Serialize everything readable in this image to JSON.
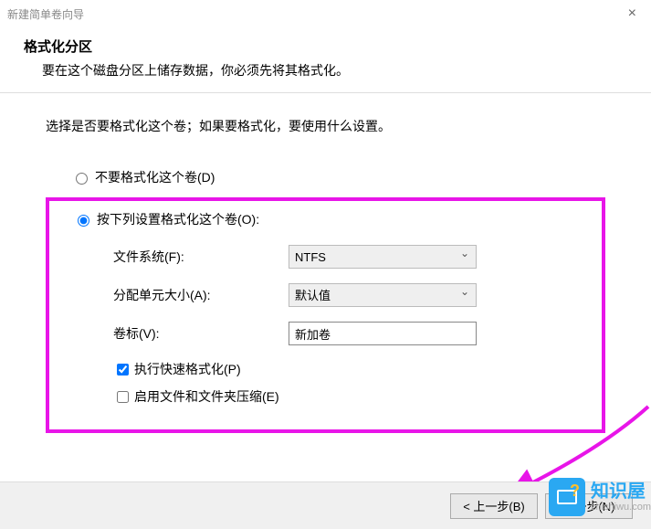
{
  "titlebar": {
    "title": "新建简单卷向导"
  },
  "header": {
    "title": "格式化分区",
    "subtitle": "要在这个磁盘分区上储存数据，你必须先将其格式化。"
  },
  "instruction": "选择是否要格式化这个卷；如果要格式化，要使用什么设置。",
  "radios": {
    "noformat": "不要格式化这个卷(D)",
    "doformat": "按下列设置格式化这个卷(O):"
  },
  "form": {
    "fs_label": "文件系统(F):",
    "fs_value": "NTFS",
    "alloc_label": "分配单元大小(A):",
    "alloc_value": "默认值",
    "volume_label": "卷标(V):",
    "volume_value": "新加卷"
  },
  "checkboxes": {
    "quick": "执行快速格式化(P)",
    "compress": "启用文件和文件夹压缩(E)"
  },
  "buttons": {
    "back": "< 上一步(B)",
    "next": "下一步(N)"
  },
  "watermark": {
    "cn": "知识屋",
    "url": "zhishiwu.com"
  }
}
